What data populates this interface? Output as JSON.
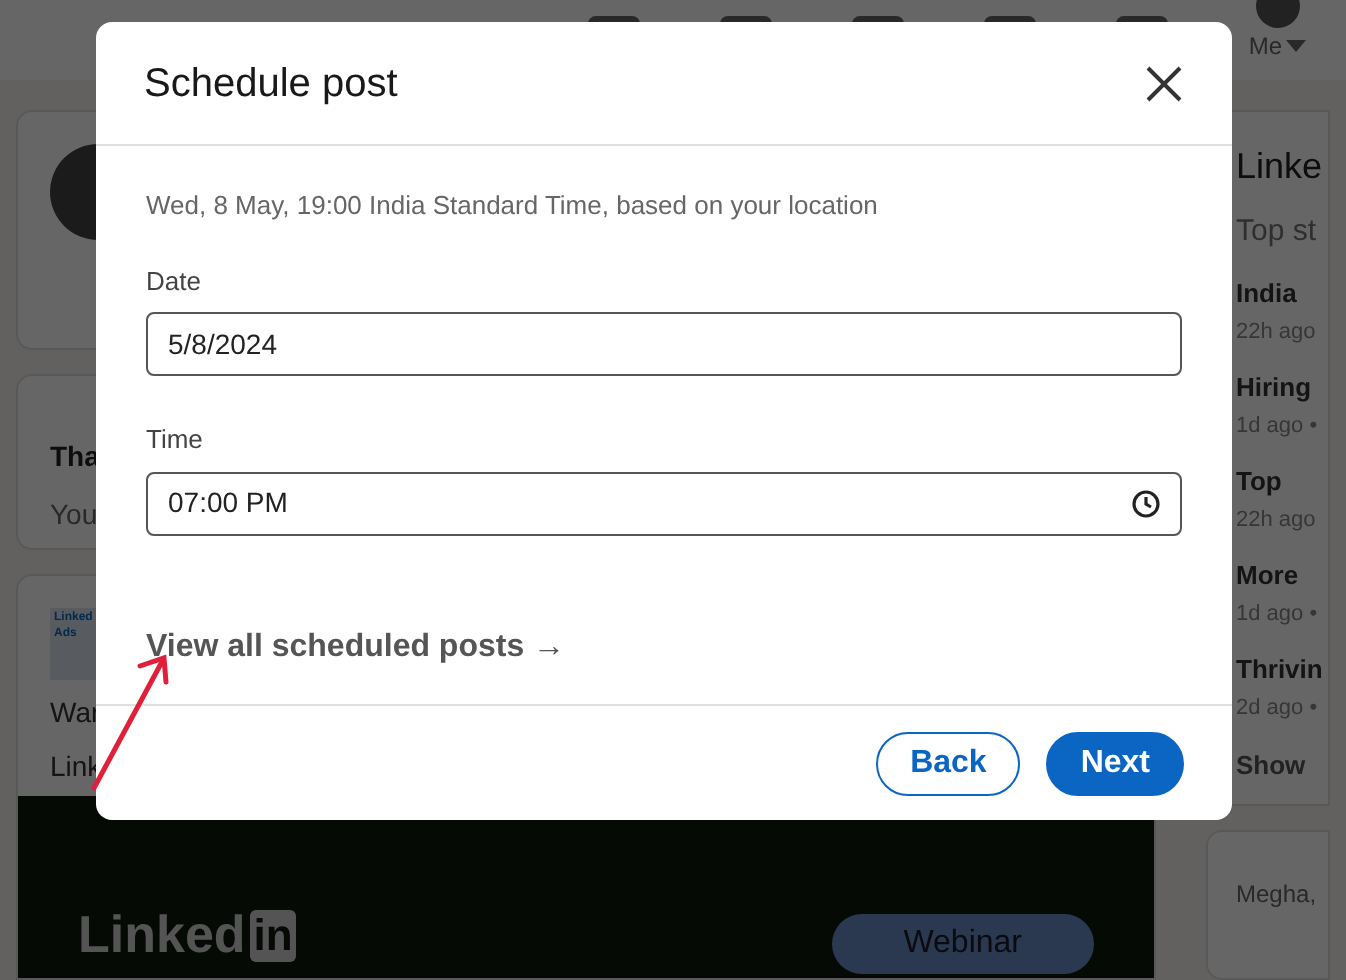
{
  "nav": {
    "me_label": "Me"
  },
  "feed": {
    "card_title": "Tha",
    "card_text": "You",
    "ad_logo": "Linked Ads",
    "ad_text_lines": [
      "War",
      "Link"
    ],
    "banner_logo": "Linked",
    "banner_logo_badge": "in",
    "banner_pill": "Webinar"
  },
  "news": {
    "title": "Linke",
    "subtitle": "Top st",
    "items": [
      {
        "headline": "India",
        "meta": "22h ago"
      },
      {
        "headline": "Hiring",
        "meta": "1d ago •"
      },
      {
        "headline": "Top",
        "meta": "22h ago"
      },
      {
        "headline": "More",
        "meta": "1d ago •"
      },
      {
        "headline": "Thrivin",
        "meta": "2d ago •"
      }
    ],
    "show_more": "Show",
    "footer_card_text": "Megha,"
  },
  "modal": {
    "title": "Schedule post",
    "description": "Wed, 8 May, 19:00 India Standard Time, based on your location",
    "fields": [
      {
        "label": "Date",
        "value": "5/8/2024",
        "kind": "date"
      },
      {
        "label": "Time",
        "value": "07:00 PM",
        "kind": "time"
      }
    ],
    "link": "View all scheduled posts →",
    "buttons": [
      {
        "label": "Back",
        "kind": "secondary"
      },
      {
        "label": "Next",
        "kind": "primary"
      }
    ]
  }
}
